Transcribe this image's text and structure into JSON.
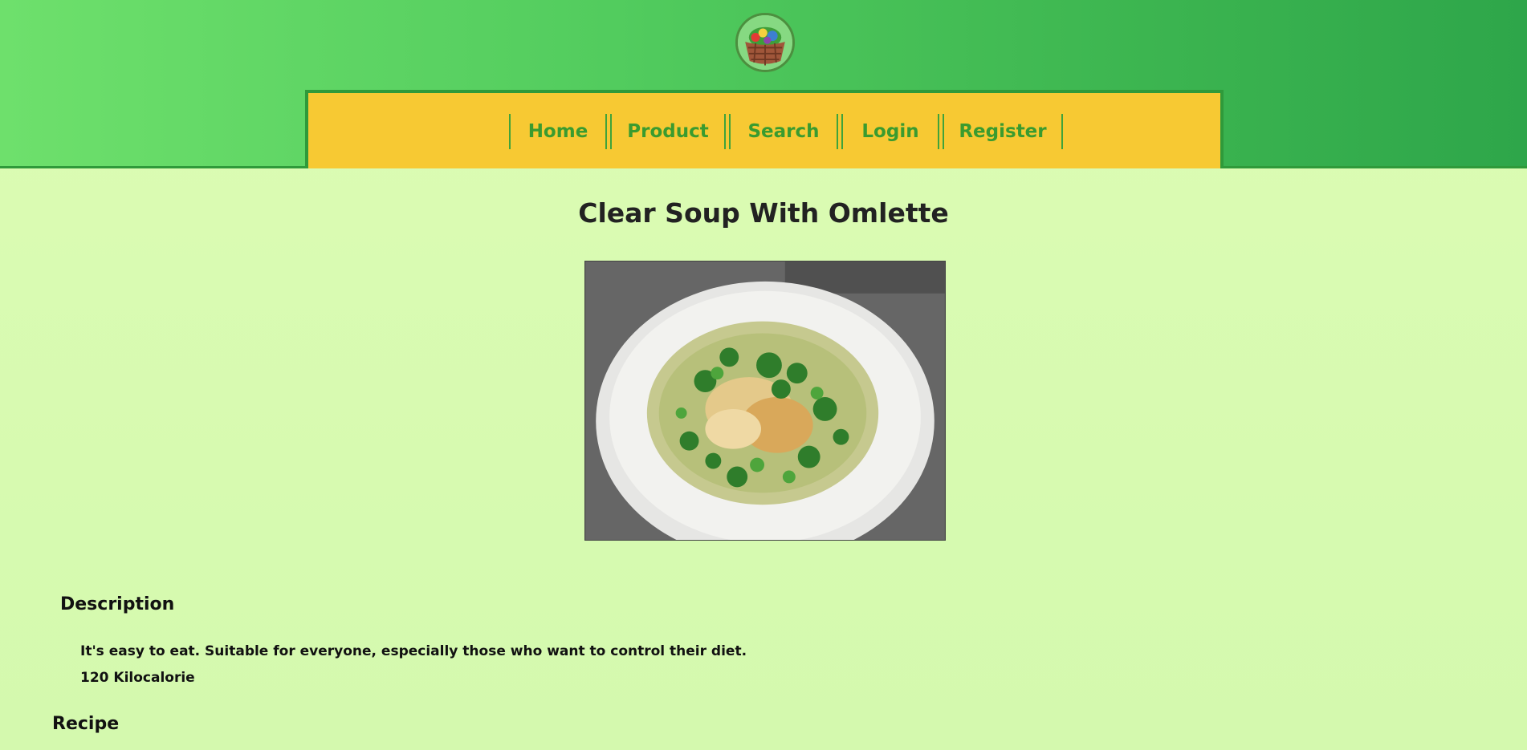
{
  "header": {
    "logo_alt": "vegetable basket logo",
    "nav": [
      {
        "label": "Home"
      },
      {
        "label": "Product"
      },
      {
        "label": "Search"
      },
      {
        "label": "Login"
      },
      {
        "label": "Register"
      }
    ]
  },
  "main": {
    "title": "Clear Soup With Omlette",
    "image_alt": "bowl of clear soup with omelette and coriander",
    "description": {
      "heading": "Description",
      "text": "It's easy to eat. Suitable for everyone, especially those who want to control their diet.",
      "calories": "120 Kilocalorie"
    },
    "recipe": {
      "heading": "Recipe"
    }
  },
  "colors": {
    "header_green": "#52cc5e",
    "navbar_yellow": "#f7c933",
    "nav_text_green": "#3a9b2f",
    "page_background": "#dcfcb4"
  }
}
